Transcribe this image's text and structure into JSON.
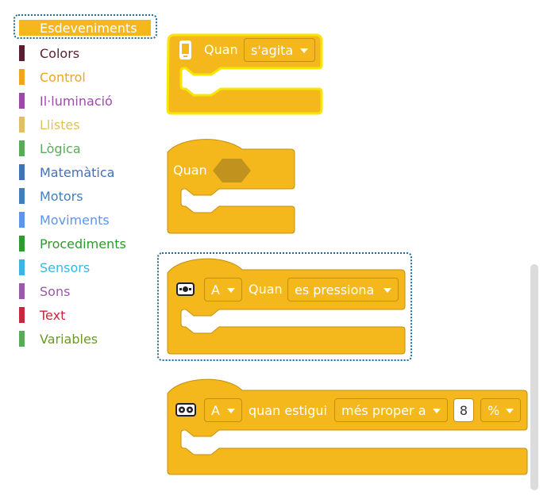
{
  "categories": [
    {
      "label": "Esdeveniments",
      "color": "#f4b81c",
      "selected": true
    },
    {
      "label": "Colors",
      "color": "#5a1f2f"
    },
    {
      "label": "Control",
      "color": "#f2a31f"
    },
    {
      "label": "Il·luminació",
      "color": "#9b4aa8"
    },
    {
      "label": "Llistes",
      "color": "#e0c060"
    },
    {
      "label": "Lògica",
      "color": "#5aaa5a"
    },
    {
      "label": "Matemàtica",
      "color": "#3f73b8"
    },
    {
      "label": "Motors",
      "color": "#3f7fc0"
    },
    {
      "label": "Moviments",
      "color": "#5a96ee"
    },
    {
      "label": "Procediments",
      "color": "#2f9a2f"
    },
    {
      "label": "Sensors",
      "color": "#3ab6e6"
    },
    {
      "label": "Sons",
      "color": "#9a5aa8"
    },
    {
      "label": "Text",
      "color": "#c8283c"
    },
    {
      "label": "Variables",
      "color": "#6a9a2a"
    }
  ],
  "blocks": {
    "shake": {
      "label": "Quan",
      "dropdown": "s'agita",
      "icon": "phone-icon"
    },
    "generic": {
      "label": "Quan",
      "slot": "boolean-slot"
    },
    "touch": {
      "port": "A",
      "label": "Quan",
      "dropdown": "es pressiona",
      "icon": "touch-sensor-icon"
    },
    "distance": {
      "port": "A",
      "label": "quan estigui",
      "dropdown": "més proper a",
      "value": "8",
      "unit": "%",
      "icon": "ultrasonic-sensor-icon"
    }
  },
  "colors": {
    "block": "#f4b81c",
    "block_border": "#c58f0e",
    "highlight": "#f7e600",
    "selection": "#1f6b9a"
  }
}
